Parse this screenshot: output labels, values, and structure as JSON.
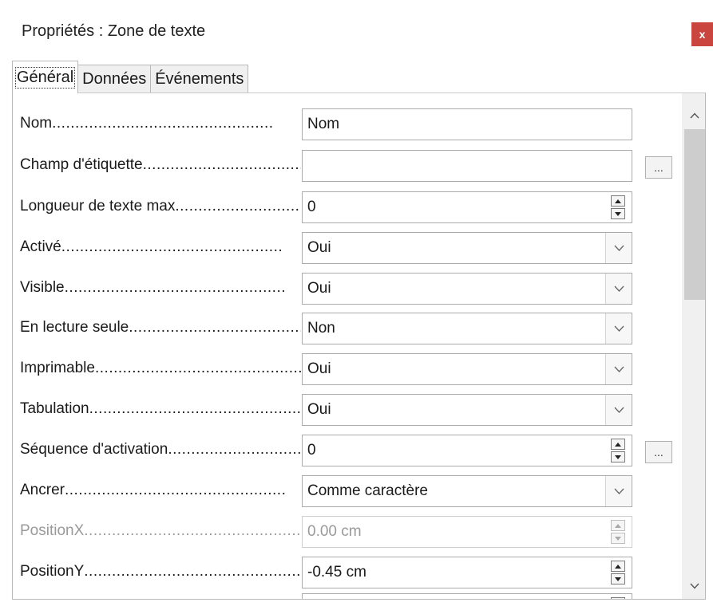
{
  "window": {
    "title": "Propriétés : Zone de texte",
    "close_label": "x"
  },
  "tabs": [
    {
      "label": "Général",
      "active": true
    },
    {
      "label": "Données",
      "active": false
    },
    {
      "label": "Événements",
      "active": false
    }
  ],
  "properties": {
    "nom": {
      "label": "Nom",
      "dots": "................................................",
      "value": "Nom"
    },
    "etiquette": {
      "label": "Champ d'étiquette",
      "dots": ".........................................",
      "value": "",
      "more": "..."
    },
    "longueur": {
      "label": "Longueur de texte max",
      "dots": "...................................",
      "value": "0"
    },
    "active": {
      "label": "Activé",
      "dots": "................................................",
      "value": "Oui"
    },
    "visible": {
      "label": "Visible",
      "dots": "................................................",
      "value": "Oui"
    },
    "lecture": {
      "label": "En lecture seule",
      "dots": "..........................................",
      "value": "Non"
    },
    "imprimable": {
      "label": "Imprimable",
      "dots": "................................................",
      "value": "Oui"
    },
    "tabulation": {
      "label": "Tabulation",
      "dots": "................................................",
      "value": "Oui"
    },
    "sequence": {
      "label": "Séquence d'activation",
      "dots": "...................................",
      "value": "0",
      "more": "..."
    },
    "ancrer": {
      "label": "Ancrer",
      "dots": "................................................",
      "value": "Comme caractère"
    },
    "positionx": {
      "label": "PositionX",
      "dots": "................................................",
      "value": "0.00 cm"
    },
    "positiony": {
      "label": "PositionY",
      "dots": "................................................",
      "value": "-0.45 cm"
    }
  },
  "colors": {
    "close": "#c9453d",
    "disabled_text": "#9a9a9a",
    "scroll_thumb": "#cdcdcd"
  },
  "icons": {
    "close": "close-icon",
    "dropdown": "chevron-down-icon",
    "spin_up": "triangle-up-icon",
    "spin_down": "triangle-down-icon",
    "scroll_up": "chevron-up-icon",
    "scroll_down": "chevron-down-icon"
  }
}
